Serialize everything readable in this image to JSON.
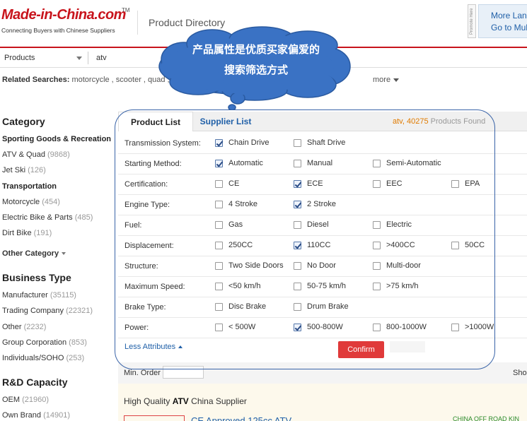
{
  "header": {
    "logo_text": "Made-in-China.com",
    "logo_tm": "TM",
    "slogan": "Connecting Buyers with Chinese Suppliers",
    "section_title": "Product Directory",
    "promo_tab": "Promote Here",
    "lang_line1": "More Lang",
    "lang_line2": "Go to Mult"
  },
  "search": {
    "category": "Products",
    "query": "atv"
  },
  "related": {
    "label": "Related Searches:",
    "terms": " motorcycle , scooter , quad , go",
    "more": "more"
  },
  "sidebar": {
    "category_title": "Category",
    "category_items": [
      {
        "label": "Sporting Goods & Recreation",
        "count": "",
        "bold": true
      },
      {
        "label": "ATV & Quad",
        "count": "(9868)",
        "bold": false
      },
      {
        "label": "Jet Ski",
        "count": "(126)",
        "bold": false
      },
      {
        "label": "Transportation",
        "count": "",
        "bold": true
      },
      {
        "label": "Motorcycle",
        "count": "(454)",
        "bold": false
      },
      {
        "label": "Electric Bike & Parts",
        "count": "(485)",
        "bold": false
      },
      {
        "label": "Dirt Bike",
        "count": "(191)",
        "bold": false
      }
    ],
    "other_category": "Other Category",
    "business_title": "Business Type",
    "business_items": [
      {
        "label": "Manufacturer",
        "count": "(35115)"
      },
      {
        "label": "Trading Company",
        "count": "(22321)"
      },
      {
        "label": "Other",
        "count": "(2232)"
      },
      {
        "label": "Group Corporation",
        "count": "(853)"
      },
      {
        "label": "Individuals/SOHO",
        "count": "(253)"
      }
    ],
    "rd_title": "R&D Capacity",
    "rd_items": [
      {
        "label": "OEM",
        "count": "(21960)"
      },
      {
        "label": "Own Brand",
        "count": "(14901)"
      }
    ]
  },
  "tabs": {
    "product_list": "Product List",
    "supplier_list": "Supplier List",
    "found_query": "atv,",
    "found_count": "40275",
    "found_suffix": "Products Found"
  },
  "attributes": [
    {
      "label": "Transmission System:",
      "options": [
        {
          "text": "Chain Drive",
          "checked": true
        },
        {
          "text": "Shaft Drive",
          "checked": false
        }
      ]
    },
    {
      "label": "Starting Method:",
      "options": [
        {
          "text": "Automatic",
          "checked": true
        },
        {
          "text": "Manual",
          "checked": false
        },
        {
          "text": "Semi-Automatic",
          "checked": false
        }
      ]
    },
    {
      "label": "Certification:",
      "options": [
        {
          "text": "CE",
          "checked": false
        },
        {
          "text": "ECE",
          "checked": true
        },
        {
          "text": "EEC",
          "checked": false
        },
        {
          "text": "EPA",
          "checked": false
        }
      ]
    },
    {
      "label": "Engine Type:",
      "options": [
        {
          "text": "4 Stroke",
          "checked": false
        },
        {
          "text": "2 Stroke",
          "checked": true
        }
      ]
    },
    {
      "label": "Fuel:",
      "options": [
        {
          "text": "Gas",
          "checked": false
        },
        {
          "text": "Diesel",
          "checked": false
        },
        {
          "text": "Electric",
          "checked": false
        }
      ]
    },
    {
      "label": "Displacement:",
      "options": [
        {
          "text": "250CC",
          "checked": false
        },
        {
          "text": "110CC",
          "checked": true
        },
        {
          "text": ">400CC",
          "checked": false
        },
        {
          "text": "50CC",
          "checked": false
        }
      ]
    },
    {
      "label": "Structure:",
      "options": [
        {
          "text": "Two Side Doors",
          "checked": false
        },
        {
          "text": "No Door",
          "checked": false
        },
        {
          "text": "Multi-door",
          "checked": false
        }
      ]
    },
    {
      "label": "Maximum Speed:",
      "options": [
        {
          "text": "<50 km/h",
          "checked": false
        },
        {
          "text": "50-75 km/h",
          "checked": false
        },
        {
          "text": ">75 km/h",
          "checked": false
        }
      ]
    },
    {
      "label": "Brake Type:",
      "options": [
        {
          "text": "Disc Brake",
          "checked": false
        },
        {
          "text": "Drum Brake",
          "checked": false
        }
      ]
    },
    {
      "label": "Power:",
      "options": [
        {
          "text": "< 500W",
          "checked": false
        },
        {
          "text": "500-800W",
          "checked": true
        },
        {
          "text": "800-1000W",
          "checked": false
        },
        {
          "text": ">1000W",
          "checked": false
        }
      ]
    }
  ],
  "filter_actions": {
    "less_attributes": "Less Attributes",
    "confirm": "Confirm"
  },
  "results": {
    "min_order_label": "Min. Order :",
    "show_label": "Sho",
    "hq_prefix": "High Quality ",
    "hq_bold": "ATV",
    "hq_suffix": " China Supplier",
    "product_title": "CE Approved 125cc ATV",
    "supplier_name": "CHINA OFF ROAD KIN"
  },
  "annotation": {
    "line1": "产品属性是优质买家偏爱的",
    "line2": "搜索筛选方式"
  },
  "colors": {
    "brand_red": "#c8141c",
    "link_blue": "#2060a8",
    "confirm_red": "#e03a3a",
    "cloud_blue": "#3a72c4"
  }
}
